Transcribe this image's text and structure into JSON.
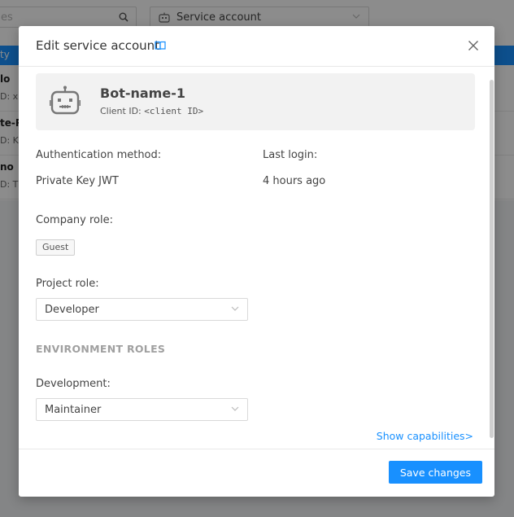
{
  "background": {
    "search_placeholder": "es",
    "service_select": "Service account",
    "header_text": "ty",
    "rows": [
      {
        "name": "lo",
        "sub": "D: x"
      },
      {
        "name": "te-P",
        "sub": "D: K"
      },
      {
        "name": "no",
        "sub": "D: T"
      }
    ]
  },
  "modal": {
    "title": "Edit service account",
    "bot_name": "Bot-name-1",
    "client_id_label": "Client ID:",
    "client_id_value": "<client ID>",
    "auth_label": "Authentication method:",
    "auth_value": "Private Key JWT",
    "last_login_label": "Last login:",
    "last_login_value": "4 hours ago",
    "company_role_label": "Company role:",
    "company_role_tag": "Guest",
    "project_role_label": "Project role:",
    "project_role_value": "Developer",
    "env_section_title": "ENVIRONMENT ROLES",
    "development_label": "Development:",
    "development_value": "Maintainer",
    "show_capabilities": "Show capabilities>",
    "save_button": "Save changes"
  },
  "icons": {
    "close": "close-icon",
    "doc": "book-icon",
    "bot": "bot-icon",
    "chevron": "chevron-down-icon",
    "search": "search-icon"
  },
  "colors": {
    "primary": "#1890ff",
    "overlay": "rgba(0,0,0,0.45)",
    "card": "#f2f2f2"
  }
}
